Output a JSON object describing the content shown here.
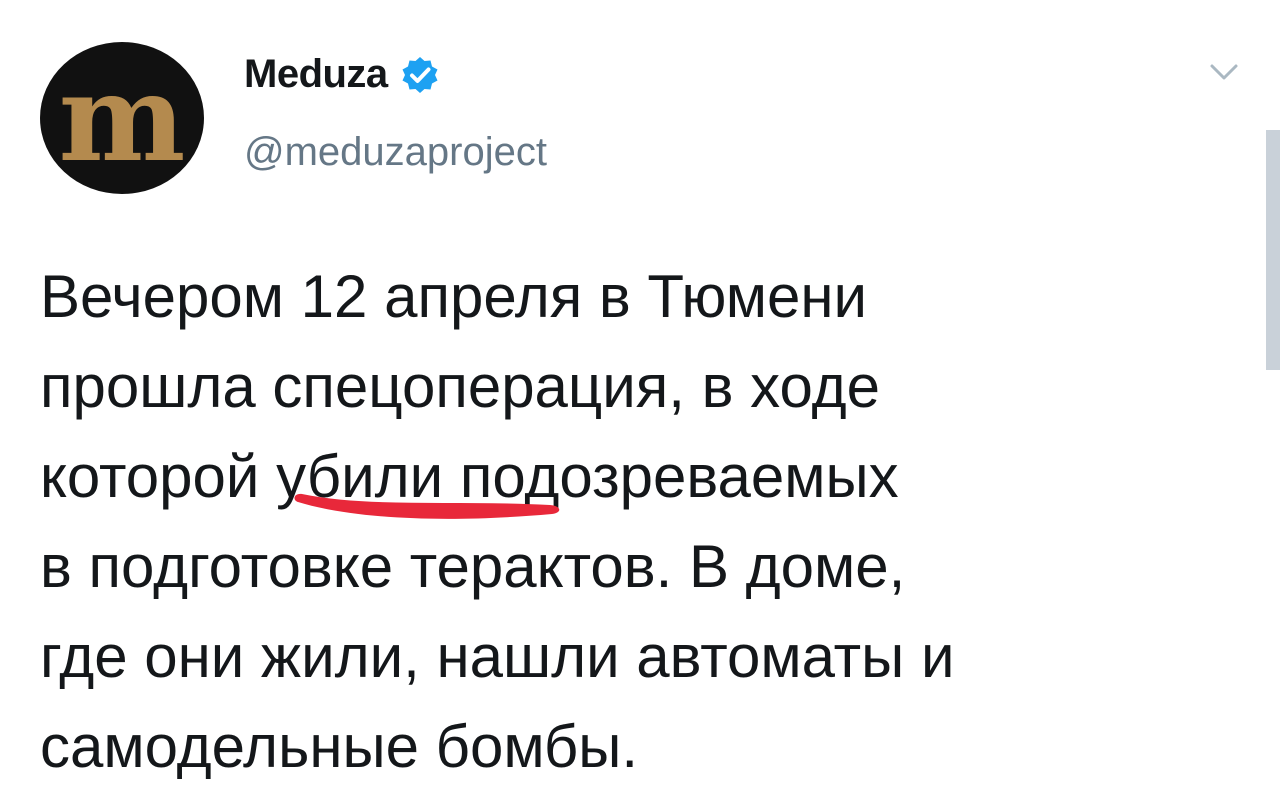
{
  "account": {
    "display_name": "Meduza",
    "handle": "@meduzaproject",
    "avatar_glyph": "m",
    "avatar_background": "#111111",
    "avatar_letter_color": "#b48a4e",
    "verified": true,
    "verified_color": "#1da1f2"
  },
  "tweet": {
    "lines": [
      "Вечером 12 апреля в Тюмени",
      "прошла спецоперация, в ходе",
      "которой убили подозреваемых",
      "в подготовке терактов. В доме,",
      "где они жили, нашли автоматы и",
      "самодельные бомбы."
    ],
    "highlighted_word": "убили",
    "highlight_color": "#e8283a"
  },
  "icons": {
    "more_menu": "chevron-down-icon",
    "verified": "verified-badge-icon"
  }
}
